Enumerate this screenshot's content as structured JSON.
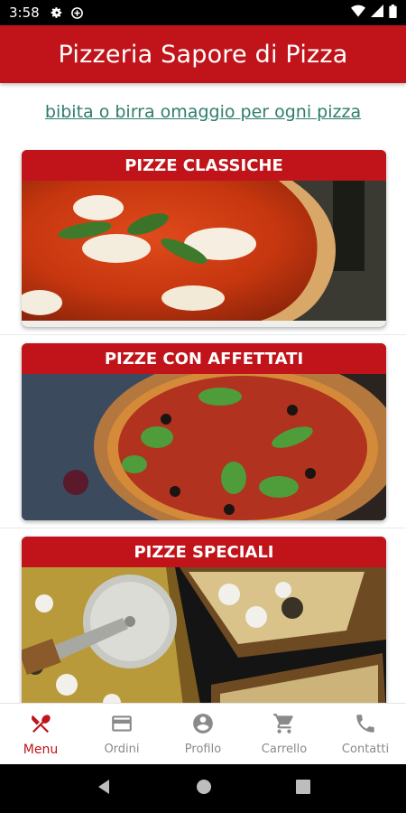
{
  "status": {
    "time": "3:58"
  },
  "app": {
    "title": "Pizzeria Sapore di Pizza"
  },
  "promo": {
    "text": "bibita o birra omaggio per ogni pizza"
  },
  "categories": [
    {
      "title": "PIZZE CLASSICHE"
    },
    {
      "title": "PIZZE CON AFFETTATI"
    },
    {
      "title": "PIZZE SPECIALI"
    }
  ],
  "nav": {
    "items": [
      {
        "label": "Menu",
        "icon": "fork-knife-icon"
      },
      {
        "label": "Ordini",
        "icon": "credit-card-icon"
      },
      {
        "label": "Profilo",
        "icon": "account-icon"
      },
      {
        "label": "Carrello",
        "icon": "cart-icon"
      },
      {
        "label": "Contatti",
        "icon": "phone-icon"
      }
    ],
    "active_index": 0
  },
  "colors": {
    "brand": "#c0141a",
    "link": "#2e7d6b",
    "inactive": "#8a8a8a"
  }
}
